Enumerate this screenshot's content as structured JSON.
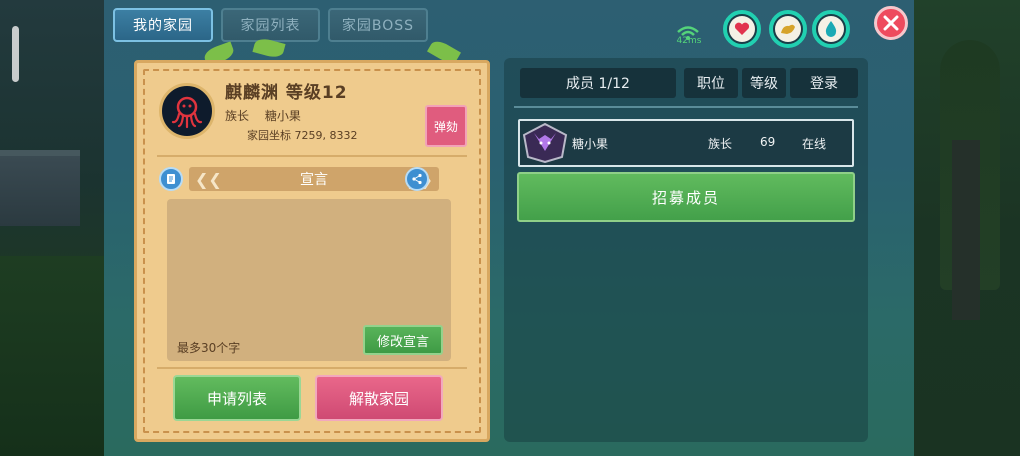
{
  "tabs": [
    {
      "label": "我的家园"
    },
    {
      "label": "家园列表"
    },
    {
      "label": "家园BOSS"
    }
  ],
  "network": {
    "latency": "42ms"
  },
  "status_icons": [
    "heart-icon",
    "arm-icon",
    "water-drop-icon"
  ],
  "colors": {
    "accent": "#21d0b1",
    "green_button": "#4fa94f",
    "pink_button": "#dc5a80",
    "card_bg": "#efcb8d"
  },
  "clan": {
    "title": "麒麟渊 等级12",
    "leader_label": "族长",
    "leader_name": "糖小果",
    "coords_text": "家园坐标 7259, 8332",
    "impeach_label": "弹劾",
    "declaration_title": "宣言",
    "declaration_hint": "最多30个字",
    "edit_label": "修改宣言",
    "apply_list_label": "申请列表",
    "disband_label": "解散家园"
  },
  "members": {
    "headers": {
      "count": "成员 1/12",
      "role": "职位",
      "level": "等级",
      "login": "登录"
    },
    "rows": [
      {
        "name": "糖小果",
        "role": "族长",
        "level": "69",
        "status": "在线"
      }
    ],
    "recruit_label": "招募成员"
  }
}
